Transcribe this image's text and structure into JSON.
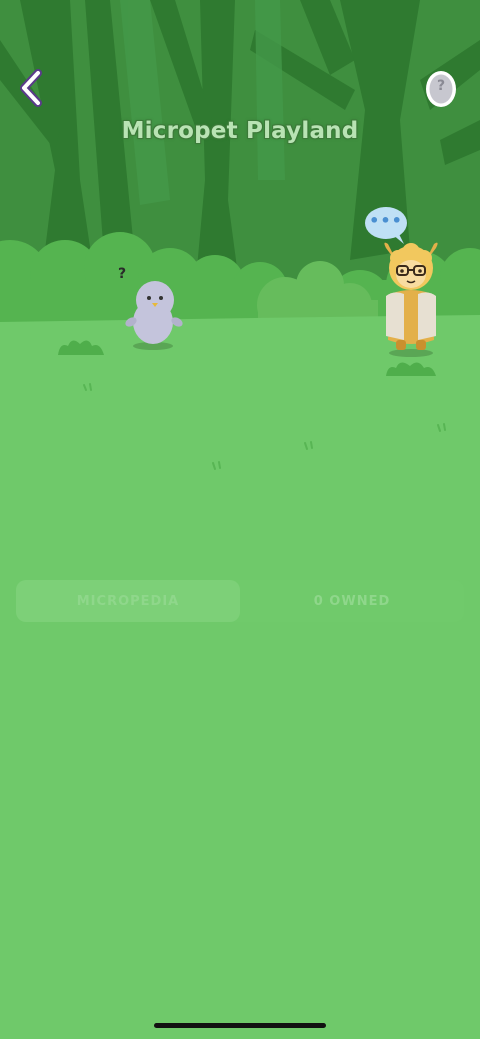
{
  "header": {
    "title": "Micropet Playland",
    "back_icon": "chevron-left-icon",
    "help_icon": "question-egg-icon",
    "help_symbol": "?"
  },
  "scene": {
    "unknown_pet_mark": "?",
    "speech_bubble_text": "•••"
  },
  "tabs": [
    {
      "label": "MICROPEDIA",
      "active": true
    },
    {
      "label": "0 OWNED",
      "active": false
    }
  ],
  "colors": {
    "ground": "#6fc96a",
    "forest": "#3f8f3f",
    "bush": "#55b450",
    "title_text": "#b9e3b4"
  }
}
